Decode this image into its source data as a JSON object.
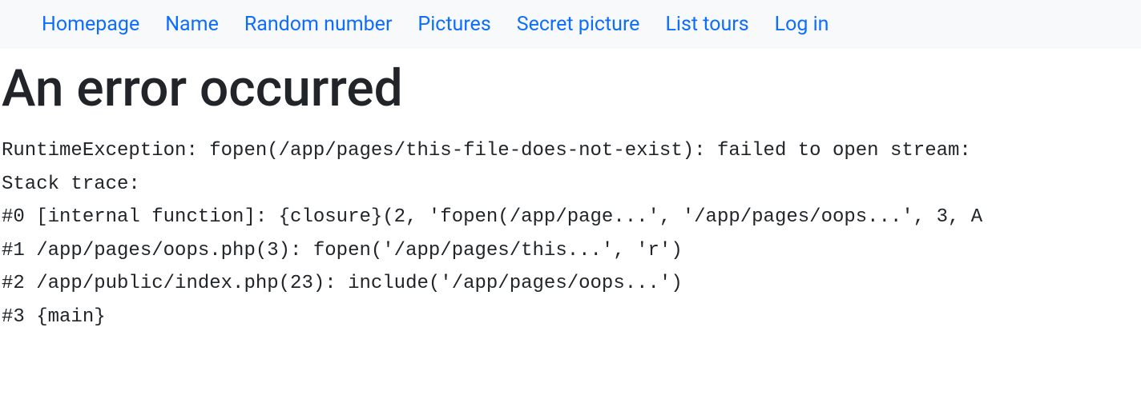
{
  "nav": {
    "items": [
      {
        "label": "Homepage"
      },
      {
        "label": "Name"
      },
      {
        "label": "Random number"
      },
      {
        "label": "Pictures"
      },
      {
        "label": "Secret picture"
      },
      {
        "label": "List tours"
      },
      {
        "label": "Log in"
      }
    ]
  },
  "page": {
    "title": "An error occurred"
  },
  "error": {
    "lines": [
      "RuntimeException: fopen(/app/pages/this-file-does-not-exist): failed to open stream: ",
      "Stack trace:",
      "#0 [internal function]: {closure}(2, 'fopen(/app/page...', '/app/pages/oops...', 3, A",
      "#1 /app/pages/oops.php(3): fopen('/app/pages/this...', 'r')",
      "#2 /app/public/index.php(23): include('/app/pages/oops...')",
      "#3 {main}"
    ]
  }
}
